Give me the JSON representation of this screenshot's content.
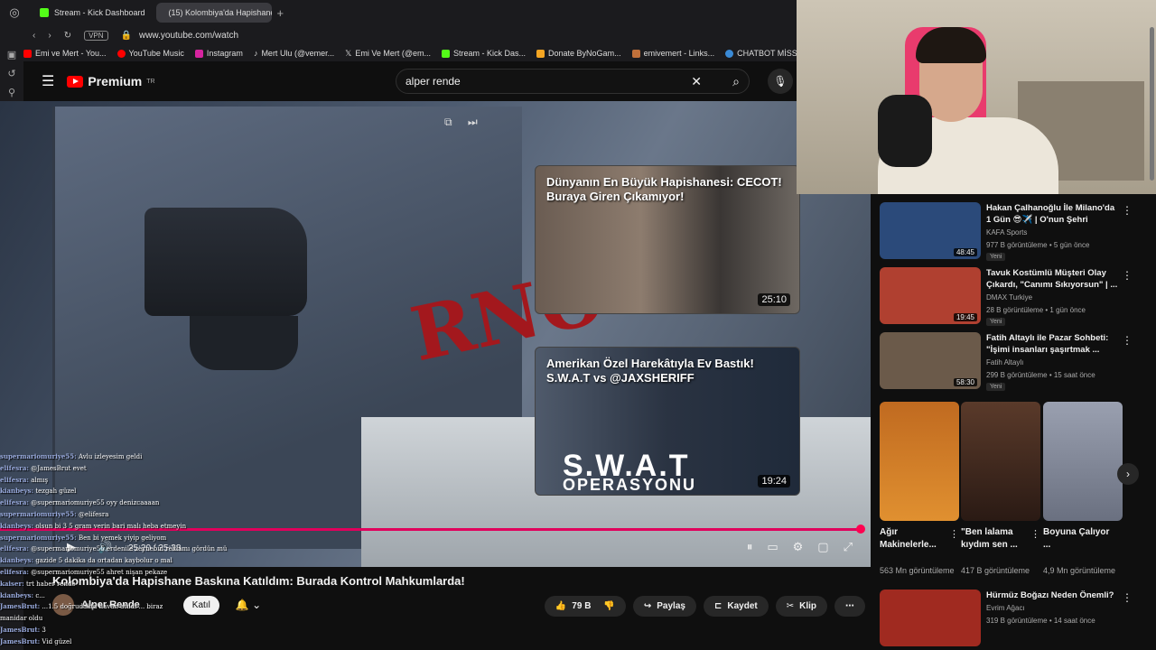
{
  "browser": {
    "tabs": [
      {
        "label": "Stream - Kick Dashboard"
      },
      {
        "label": "(15) Kolombiya'da Hapishane"
      }
    ],
    "url": "www.youtube.com/watch",
    "vpn": "VPN",
    "bookmarks": [
      "Emi ve Mert - You...",
      "YouTube Music",
      "Instagram",
      "Mert Ulu (@vemer...",
      "Emi Ve Mert (@em...",
      "Stream - Kick Das...",
      "Donate ByNoGam...",
      "emivemert - Links...",
      "CHATBOT MİSSX"
    ]
  },
  "youtube": {
    "brand": "Premium",
    "region": "TR",
    "search_value": "alper rende",
    "video": {
      "time": "25:20 / 25:38",
      "progress": 0.988,
      "title": "Kolombiya'da Hapishane Baskına Katıldım: Burada Kontrol Mahkumlarda!",
      "channel": "Alper Rende",
      "join": "Katıl",
      "likes": "79 B",
      "share": "Paylaş",
      "save": "Kaydet",
      "clip": "Klip"
    },
    "endcards": [
      {
        "title": "Dünyanın En Büyük Hapishanesi: CECOT! Buraya Giren Çıkamıyor!",
        "duration": "25:10"
      },
      {
        "title": "Amerikan Özel Harekâtıyla Ev Bastık! S.W.A.T vs @JAXSHERIFF",
        "duration": "19:24",
        "overlay1": "S.W.A.T",
        "overlay2": "OPERASYONU"
      }
    ],
    "recommendations": [
      {
        "title": "Hakan Çalhanoğlu İle Milano'da 1 Gün 😎✈️ | O'nun Şehri",
        "channel": "KAFA Sports",
        "meta": "977 B görüntüleme • 5 gün önce",
        "badge": "Yeni",
        "duration": "48:45",
        "color": "#2b4a7a"
      },
      {
        "title": "Tavuk Kostümlü Müşteri Olay Çıkardı, \"Canımı Sıkıyorsun\" | ...",
        "channel": "DMAX Turkiye",
        "meta": "28 B görüntüleme • 1 gün önce",
        "badge": "Yeni",
        "duration": "19:45",
        "color": "#b04030"
      },
      {
        "title": "Fatih Altaylı ile Pazar Sohbeti: \"İşimi insanları şaşırtmak ...",
        "channel": "Fatih Altaylı",
        "meta": "299 B görüntüleme • 15 saat önce",
        "badge": "Yeni",
        "duration": "58:30",
        "color": "#6b5a4a"
      }
    ],
    "shorts": [
      {
        "title": "Ağır Makinelerle...",
        "views": "563 Mn görüntüleme",
        "color": "#c06a20"
      },
      {
        "title": "\"Ben lalama kıydım sen ...",
        "views": "417 B görüntüleme",
        "color": "#5a3a2a"
      },
      {
        "title": "Boyuna Çalıyor ...",
        "views": "4,9 Mn görüntüleme",
        "color": "#9aa0b0"
      }
    ],
    "last_rec": {
      "title": "Hürmüz Boğazı Neden Önemli?",
      "channel": "Evrim Ağacı",
      "meta": "319 B görüntüleme • 14 saat önce",
      "color": "#a02a20"
    }
  },
  "chat": [
    {
      "u": "supermariomuriye55:",
      "m": "Avlu izleyesim geldi"
    },
    {
      "u": "elifesra:",
      "m": "@JamesBrut evet"
    },
    {
      "u": "elifesra:",
      "m": "almış"
    },
    {
      "u": "kianbeys:",
      "m": "tezgah güzel"
    },
    {
      "u": "elifesra:",
      "m": "@supermariomuriye55 oyy denizcaaaan"
    },
    {
      "u": "supermariomuriye55:",
      "m": "@elifesra"
    },
    {
      "u": "kianbeys:",
      "m": "olsun bi 3 5 gram verin bari malı heba etmeyin"
    },
    {
      "u": "supermariomuriye55:",
      "m": "Ben bi yemek yiyip geliyom"
    },
    {
      "u": "elifesra:",
      "m": "@supermariomuriye55 erdenile zeynebin reklamı gördün mü"
    },
    {
      "u": "kianbeys:",
      "m": "gazide 5 dakika da ortadan kaybolur o mal"
    },
    {
      "u": "elifesra:",
      "m": "@supermariomuriye55 ahret nişan pekaze"
    },
    {
      "u": "kaiser:",
      "m": "trt haber rende"
    },
    {
      "u": "kianbeys:",
      "m": "c..."
    },
    {
      "u": "JamesBrut:",
      "m": "...1.5 doğrudakta havan atıldı ... biraz"
    },
    {
      "u": "",
      "m": "manidar oldu"
    },
    {
      "u": "JamesBrut:",
      "m": "3"
    },
    {
      "u": "JamesBrut:",
      "m": "Vid güzel"
    }
  ]
}
